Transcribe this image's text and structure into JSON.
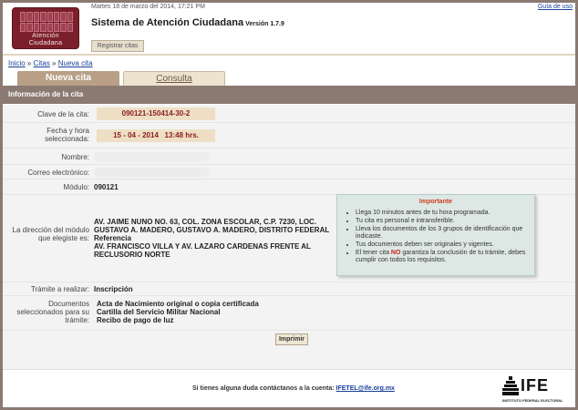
{
  "header": {
    "date": "Martes 18 de marzo del 2014, 17:21 PM",
    "help_link": "Guía de uso",
    "logo_line1": "Atención",
    "logo_line2": "Ciudadana",
    "title": "Sistema de Atención Ciudadana",
    "version": "Versión 1.7.9",
    "register_button": "Registrar citas"
  },
  "breadcrumb": {
    "home": "Inicio",
    "sep1": " » ",
    "citas": "Citas",
    "sep2": " » ",
    "nueva": "Nueva cita"
  },
  "tabs": {
    "active": "Nueva cita",
    "inactive": "Consulta"
  },
  "section": {
    "title": "Información de la cita"
  },
  "form": {
    "clave_label": "Clave de la cita:",
    "clave_value": "090121-150414-30-2",
    "fecha_label_1": "Fecha y hora",
    "fecha_label_2": "seleccionada:",
    "fecha_value": "15 - 04 - 2014   13:48 hrs.",
    "nombre_label": "Nombre:",
    "correo_label": "Correo electrónico:",
    "modulo_label": "Módulo:",
    "modulo_value": "090121",
    "direccion_label_1": "La dirección del módulo",
    "direccion_label_2": "que elegiste es:",
    "direccion_line1": "AV. JAIME NUNO NO. 63, COL. ZONA ESCOLAR, C.P. 7230, LOC.",
    "direccion_line2": "GUSTAVO A. MADERO, GUSTAVO A. MADERO, DISTRITO FEDERAL",
    "direccion_line3": "Referencia",
    "direccion_line4": "AV. FRANCISCO VILLA Y AV. LAZARO CARDENAS FRENTE AL",
    "direccion_line5": "RECLUSORIO NORTE",
    "tramite_label": "Trámite a realizar:",
    "tramite_value": "Inscripción",
    "documentos_label_1": "Documentos",
    "documentos_label_2": "seleccionados para su",
    "documentos_label_3": "trámite:",
    "documentos": [
      "Acta de Nacimiento original o copia certificada",
      "Cartilla del Servicio Militar Nacional",
      "Recibo de pago de luz"
    ],
    "print_button": "Imprimir"
  },
  "important": {
    "title": "Importante",
    "items": [
      "Llega 10 minutos antes de tu hora programada.",
      "Tu cita es personal e intransferible.",
      "Lleva los documentos de los 3 grupos de identificación que indicaste.",
      "Tus documentos deben ser originales y vigentes."
    ],
    "last_pre": "El tener cita ",
    "last_no": "NO",
    "last_post": " garantiza la conclusión de tu trámite, debes cumplir con todos los requisitos."
  },
  "footer": {
    "text": "Si tienes alguna duda contáctanos a la cuenta: ",
    "email": "IFETEL@ife.org.mx",
    "logo_text": "IFE",
    "logo_sub": "INSTITUTO FEDERAL ELECTORAL"
  },
  "colors": {
    "brand": "#7a1f2b",
    "tab_active": "#b89f86",
    "section_bar": "#8a7a72",
    "highlight": "#eedfc4",
    "important_bg": "#dde8e5"
  }
}
